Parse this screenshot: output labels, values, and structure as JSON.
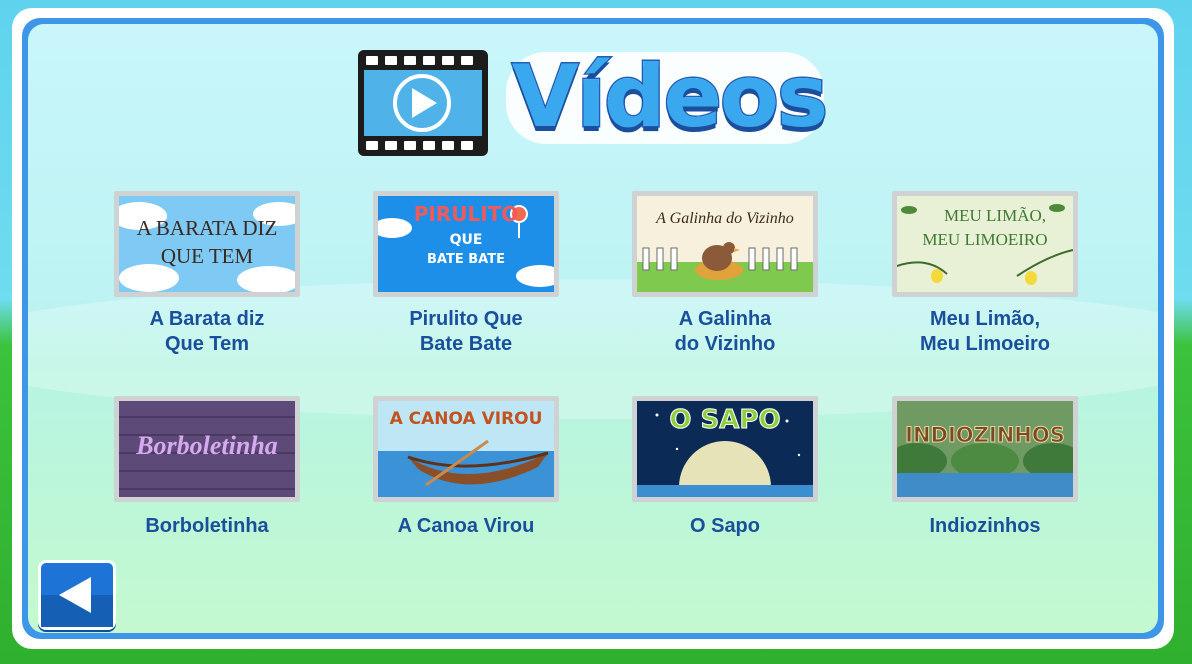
{
  "header": {
    "title": "Vídeos",
    "icon": "film-play-icon"
  },
  "colors": {
    "title_fill": "#3aa8ee",
    "title_stroke": "#1f5fb8",
    "caption": "#1a4f9c",
    "panel_border": "#3d96e8",
    "back_button": "#1e74d6"
  },
  "videos": [
    {
      "caption": "A Barata diz\nQue Tem",
      "thumb_line1": "A BARATA DIZ",
      "thumb_line2": "QUE TEM"
    },
    {
      "caption": "Pirulito Que\nBate Bate",
      "thumb_line1": "PIRULITO",
      "thumb_line2": "QUE",
      "thumb_line3": "BATE BATE"
    },
    {
      "caption": "A Galinha\ndo Vizinho",
      "thumb_line1": "A Galinha do Vizinho"
    },
    {
      "caption": "Meu Limão,\nMeu Limoeiro",
      "thumb_line1": "MEU LIMÃO,",
      "thumb_line2": "MEU LIMOEIRO"
    },
    {
      "caption": "Borboletinha",
      "thumb_line1": "Borboletinha"
    },
    {
      "caption": "A Canoa Virou",
      "thumb_line1": "A CANOA VIROU"
    },
    {
      "caption": "O Sapo",
      "thumb_line1": "O SAPO"
    },
    {
      "caption": "Indiozinhos",
      "thumb_line1": "INDIOZINHOS"
    }
  ],
  "back_button": {
    "icon": "back-arrow-icon"
  }
}
